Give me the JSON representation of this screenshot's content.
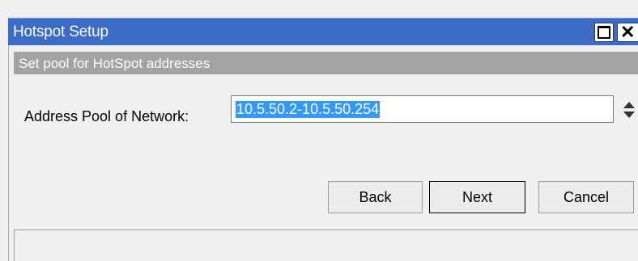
{
  "window": {
    "title": "Hotspot Setup",
    "maximize_icon": "maximize-icon",
    "close_icon": "close-icon"
  },
  "section": {
    "header": "Set pool for HotSpot addresses"
  },
  "form": {
    "pool_label": "Address Pool of Network:",
    "pool_value": "10.5.50.2-10.5.50.254",
    "spinner_icon": "up-down-arrows-icon"
  },
  "buttons": {
    "back": "Back",
    "next": "Next",
    "cancel": "Cancel"
  },
  "colors": {
    "titlebar": "#3d6cc8",
    "section_header": "#a3a3a3",
    "selection": "#3399ff"
  }
}
